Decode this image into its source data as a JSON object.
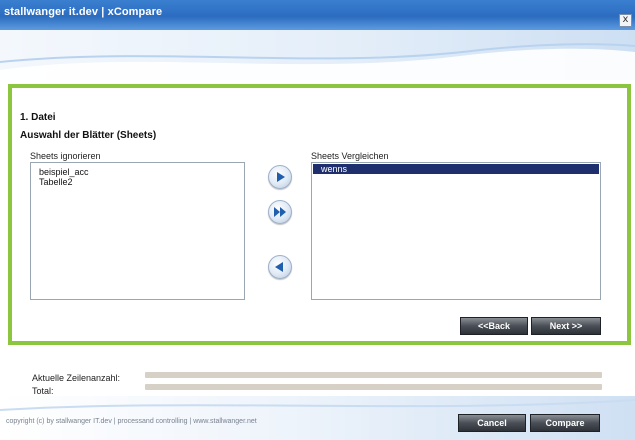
{
  "window": {
    "title": "stallwanger it.dev | xCompare",
    "close_symbol": "x"
  },
  "wizard": {
    "step": "1. Datei",
    "heading": "Auswahl der Blätter (Sheets)"
  },
  "ignored_list": {
    "caption": "Sheets ignorieren",
    "items": [
      "beispiel_acc",
      "Tabelle2"
    ]
  },
  "compare_list": {
    "caption": "Sheets Vergleichen",
    "items": [
      "wenns"
    ],
    "selected": "wenns"
  },
  "transfer_buttons": {
    "move_right_icon": "arrow-right-icon",
    "move_all_right_icon": "double-arrow-right-icon",
    "move_left_icon": "arrow-left-icon"
  },
  "navigation": {
    "back_label": "<<Back",
    "next_label": "Next >>"
  },
  "progress": {
    "rows_label": "Aktuelle Zeilenanzahl:",
    "rows_value": 0,
    "total_label": "Total:",
    "total_value": 0
  },
  "footer": {
    "copyright": "copyright (c) by stallwanger IT.dev | processand controlling   | www.stallwanger.net",
    "cancel_label": "Cancel",
    "compare_label": "Compare"
  },
  "colors": {
    "titlebar": "#2c6cc0",
    "panel_border": "#8cc63f",
    "selection": "#1f2f6e",
    "button_dark": "#3a3e45",
    "progress_track": "#d6d0c6"
  }
}
